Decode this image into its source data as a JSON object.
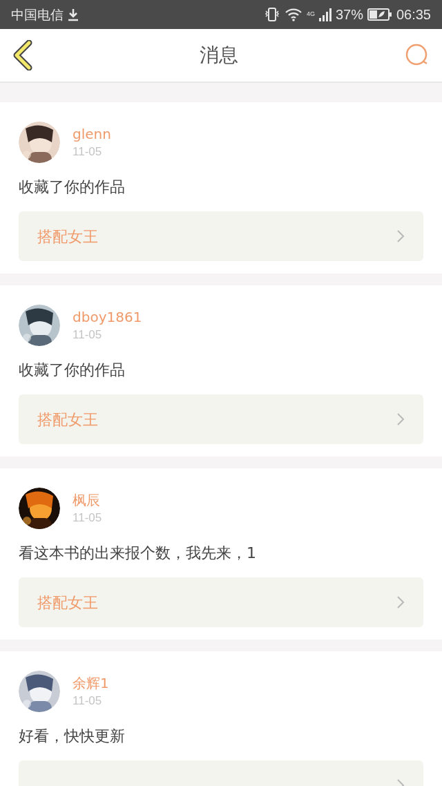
{
  "status_bar": {
    "carrier": "中国电信",
    "network": "4G",
    "battery": "37%",
    "time": "06:35"
  },
  "header": {
    "title": "消息"
  },
  "messages": [
    {
      "user": "glenn",
      "date": "11-05",
      "text": "收藏了你的作品",
      "work": "搭配女王"
    },
    {
      "user": "dboy1861",
      "date": "11-05",
      "text": "收藏了你的作品",
      "work": "搭配女王"
    },
    {
      "user": "枫辰",
      "date": "11-05",
      "text": "看这本书的出来报个数，我先来，1",
      "work": "搭配女王"
    },
    {
      "user": "余辉1",
      "date": "11-05",
      "text": "好看，快快更新"
    }
  ]
}
